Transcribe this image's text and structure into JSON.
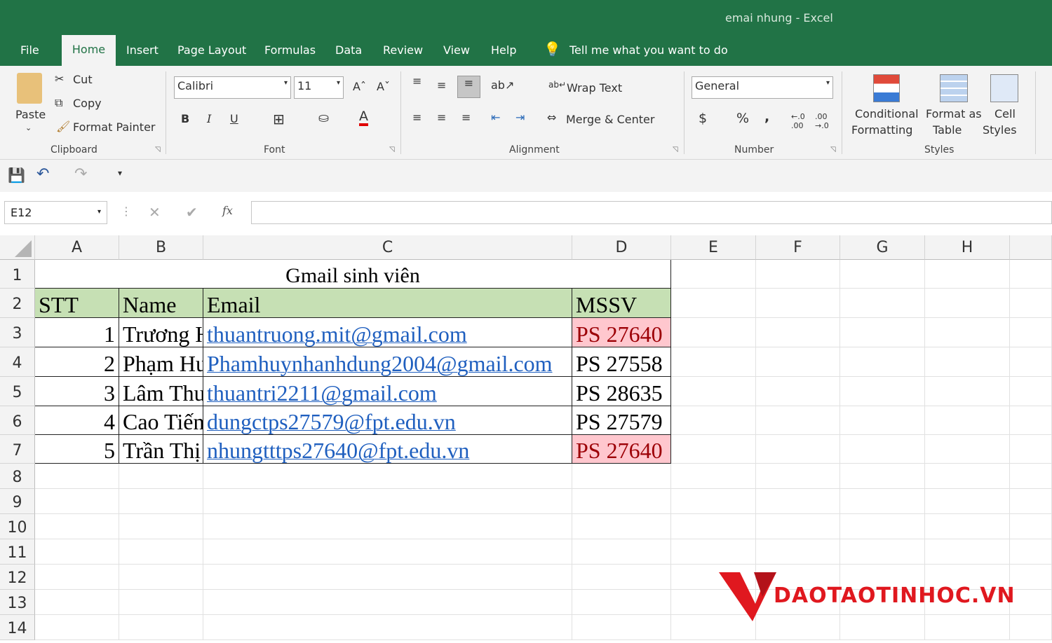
{
  "title": {
    "doc": "emai nhung  -  Excel"
  },
  "tabs": [
    "File",
    "Home",
    "Insert",
    "Page Layout",
    "Formulas",
    "Data",
    "Review",
    "View",
    "Help"
  ],
  "tell_me": "Tell me what you want to do",
  "clipboard": {
    "paste": "Paste",
    "cut": "Cut",
    "copy": "Copy",
    "format_painter": "Format Painter",
    "label": "Clipboard"
  },
  "font": {
    "name": "Calibri",
    "size": "11",
    "bold": "B",
    "italic": "I",
    "underline": "U",
    "color_a": "A",
    "label": "Font"
  },
  "alignment": {
    "wrap": "Wrap Text",
    "merge": "Merge & Center",
    "label": "Alignment"
  },
  "number": {
    "format": "General",
    "dollar": "$",
    "percent": "%",
    "comma": ",",
    "label": "Number"
  },
  "styles": {
    "conditional": "Conditional",
    "formatting": "Formatting",
    "format_as": "Format as",
    "table": "Table",
    "cell": "Cell",
    "cell_styles": "Styles",
    "label": "Styles"
  },
  "formula_bar": {
    "name_box": "E12",
    "fx": "fx",
    "value": ""
  },
  "columns": [
    "A",
    "B",
    "C",
    "D",
    "E",
    "F",
    "G",
    "H"
  ],
  "rows": [
    "1",
    "2",
    "3",
    "4",
    "5",
    "6",
    "7",
    "8",
    "9",
    "10",
    "11",
    "12",
    "13",
    "14"
  ],
  "sheet": {
    "title": "Gmail sinh viên",
    "headers": [
      "STT",
      "Name",
      "Email",
      "MSSV"
    ],
    "records": [
      {
        "stt": "1",
        "name": "Trương H",
        "email": "thuantruong.mit@gmail.com",
        "mssv": "PS 27640",
        "dup": true
      },
      {
        "stt": "2",
        "name": "Phạm Hu",
        "email": "Phamhuynhanhdung2004@gmail.com",
        "mssv": "PS 27558",
        "dup": false
      },
      {
        "stt": "3",
        "name": "Lâm Thu",
        "email": "thuantri2211@gmail.com",
        "mssv": "PS 28635",
        "dup": false
      },
      {
        "stt": "4",
        "name": "Cao Tiến",
        "email": "dungctps27579@fpt.edu.vn",
        "mssv": "PS 27579",
        "dup": false
      },
      {
        "stt": "5",
        "name": "Trần Thị",
        "email": "nhungtttps27640@fpt.edu.vn",
        "mssv": "PS 27640",
        "dup": true
      }
    ]
  },
  "colors": {
    "excel_green": "#217346",
    "header_fill": "#c6e0b4",
    "dup_fill": "#ffc7ce",
    "dup_text": "#9c0006",
    "logo_red": "#e0181f"
  },
  "logo": {
    "text": "DAOTAOTINHOC.VN"
  }
}
